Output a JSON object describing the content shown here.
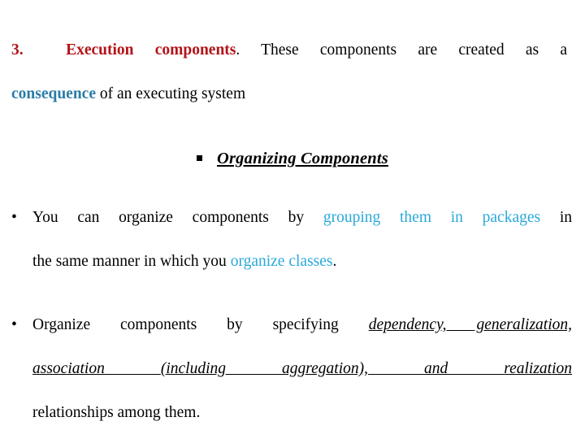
{
  "slide": {
    "background_color": "#ffffff",
    "colors": {
      "heading_red": "#b21419",
      "deep_blue": "#2a7da6",
      "cyan_blue": "#2aa9d8",
      "body_black": "#000000"
    },
    "numbered_item": {
      "marker": "3.",
      "title": "Execution components",
      "title_color": "#b21419",
      "line1_rest": ". These components are created as a",
      "line2_keyword": "consequence",
      "line2_keyword_color": "#2a7da6",
      "line2_rest": " of an executing system"
    },
    "subheading": {
      "bullet_icon": "square-bullet",
      "text": "Organizing Components"
    },
    "bullet_packages": {
      "bullet_icon": "round-bullet",
      "bullet_glyph": "•",
      "line1_a": "You can organize components by ",
      "line1_highlight": "grouping them in packages",
      "line1_b": " in",
      "line2_a": "the same manner in which you ",
      "line2_highlight": "organize classes",
      "line2_b": "."
    },
    "bullet_relationships": {
      "bullet_icon": "round-bullet",
      "bullet_glyph": "•",
      "line1_plain": "Organize components by specifying ",
      "line1_italic": "dependency, generalization,",
      "line2_italic_1": "association ",
      "line2_italic_2": "(including ",
      "line2_italic_3": "aggregation), ",
      "line2_italic_4": "and ",
      "line2_italic_5": "realization",
      "line3_plain": "relationships among them."
    }
  }
}
